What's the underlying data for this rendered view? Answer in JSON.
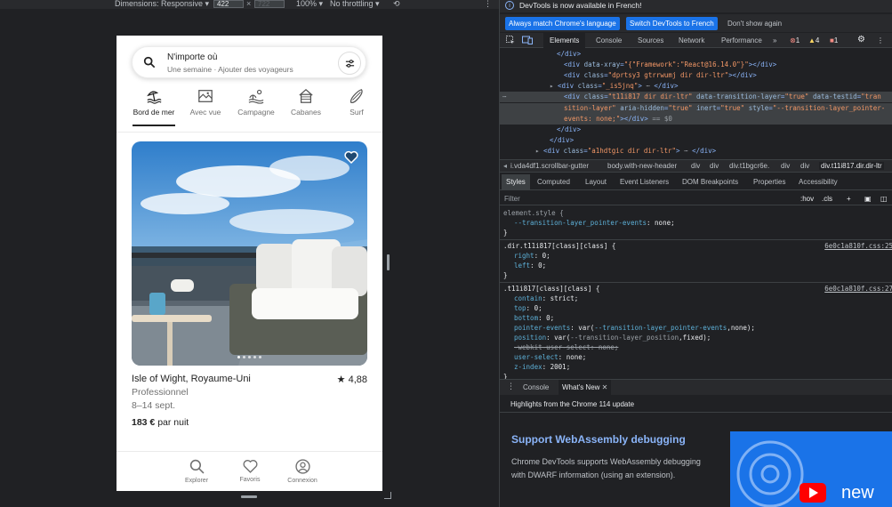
{
  "device_toolbar": {
    "dimensions_label": "Dimensions: Responsive ▾",
    "width": "422",
    "height": "722",
    "zoom": "100% ▾",
    "throttling": "No throttling ▾"
  },
  "search": {
    "title": "N'importe où",
    "subtitle": "Une semaine · Ajouter des voyageurs"
  },
  "categories": [
    {
      "label": "Bord de mer",
      "icon": "beach-icon",
      "active": true
    },
    {
      "label": "Avec vue",
      "icon": "view-icon"
    },
    {
      "label": "Campagne",
      "icon": "countryside-icon"
    },
    {
      "label": "Cabanes",
      "icon": "cabin-icon"
    },
    {
      "label": "Surf",
      "icon": "surf-icon"
    }
  ],
  "listing": {
    "title": "Isle of Wight, Royaume-Uni",
    "rating": "★ 4,88",
    "host": "Professionnel",
    "dates": "8–14 sept.",
    "price": "183 €",
    "price_suffix": " par nuit"
  },
  "tabbar": [
    {
      "label": "Explorer",
      "icon": "search-icon"
    },
    {
      "label": "Favoris",
      "icon": "heart-icon"
    },
    {
      "label": "Connexion",
      "icon": "profile-icon"
    }
  ],
  "devtools": {
    "info_text": "DevTools is now available in French!",
    "btn_match": "Always match Chrome's language",
    "btn_switch": "Switch DevTools to French",
    "btn_dont": "Don't show again",
    "tabs": [
      "Elements",
      "Console",
      "Sources",
      "Network",
      "Performance",
      "»"
    ],
    "errors": "1",
    "warnings": "4",
    "issues": "1",
    "code_lines": [
      {
        "indent": 8,
        "text": "</div>",
        "cls": "tag"
      },
      {
        "indent": 9,
        "parts": [
          [
            "tag",
            "<div "
          ],
          [
            "an",
            "data-xray"
          ],
          [
            "tag",
            "="
          ],
          [
            "av",
            "\"{\"Framework\":\"React@16.14.0\"}\""
          ],
          [
            "tag",
            "></div>"
          ]
        ]
      },
      {
        "indent": 9,
        "parts": [
          [
            "tag",
            "<div "
          ],
          [
            "an",
            "class"
          ],
          [
            "tag",
            "="
          ],
          [
            "av",
            "\"dprtsy3 gtrrwumj dir dir-ltr\""
          ],
          [
            "tag",
            "></div>"
          ]
        ]
      },
      {
        "indent": 8,
        "arrow": true,
        "parts": [
          [
            "tag",
            "<div "
          ],
          [
            "an",
            "class"
          ],
          [
            "tag",
            "="
          ],
          [
            "av",
            "\"_is5jnq\""
          ],
          [
            "tag",
            ">"
          ],
          [
            "gr",
            " ⋯ "
          ],
          [
            "tag",
            "</div>"
          ]
        ]
      },
      {
        "indent": 9,
        "sel": true,
        "parts": [
          [
            "tag",
            "<div "
          ],
          [
            "an",
            "class"
          ],
          [
            "tag",
            "="
          ],
          [
            "av",
            "\"t11i817 dir dir-ltr\" "
          ],
          [
            "an",
            "data-transition-layer"
          ],
          [
            "tag",
            "="
          ],
          [
            "av",
            "\"true\" "
          ],
          [
            "an",
            "data-testid"
          ],
          [
            "tag",
            "="
          ],
          [
            "av",
            "\"tran"
          ]
        ]
      },
      {
        "indent": 9,
        "sel": true,
        "parts": [
          [
            "av",
            "sition-layer\" "
          ],
          [
            "an",
            "aria-hidden"
          ],
          [
            "tag",
            "="
          ],
          [
            "av",
            "\"true\" "
          ],
          [
            "an",
            "inert"
          ],
          [
            "tag",
            "="
          ],
          [
            "av",
            "\"true\" "
          ],
          [
            "an",
            "style"
          ],
          [
            "tag",
            "="
          ],
          [
            "av",
            "\"--transition-layer_pointer-"
          ]
        ]
      },
      {
        "indent": 9,
        "sel": true,
        "parts": [
          [
            "av",
            "events: none;\""
          ],
          [
            "tag",
            "></div>"
          ],
          [
            "gr",
            " == $0"
          ]
        ]
      },
      {
        "indent": 8,
        "parts": [
          [
            "tag",
            "</div>"
          ]
        ]
      },
      {
        "indent": 7,
        "parts": [
          [
            "tag",
            "</div>"
          ]
        ]
      },
      {
        "indent": 6,
        "arrow": true,
        "parts": [
          [
            "tag",
            "<div "
          ],
          [
            "an",
            "class"
          ],
          [
            "tag",
            "="
          ],
          [
            "av",
            "\"a1hdtgic dir dir-ltr\""
          ],
          [
            "tag",
            ">"
          ],
          [
            "gr",
            " ⋯ "
          ],
          [
            "tag",
            "</div>"
          ]
        ]
      },
      {
        "indent": 6,
        "parts": [
          [
            "tag",
            "</div>"
          ]
        ]
      }
    ],
    "breadcrumbs": [
      "i.vda4df1.scrollbar-gutter",
      "body.with-new-header",
      "div",
      "div",
      "div.t1bgcr6e.",
      "div",
      "div",
      "div.t11i817.dir.dir-ltr"
    ],
    "subtabs": [
      "Styles",
      "Computed",
      "Layout",
      "Event Listeners",
      "DOM Breakpoints",
      "Properties",
      "Accessibility"
    ],
    "filter_placeholder": "Filter",
    "filter_hov": ":hov",
    "filter_cls": ".cls",
    "style_src1": "6e0c1a810f.css:25",
    "style_src2": "6e0c1a810f.css:27",
    "drawer_tabs": [
      "Console",
      "What's New"
    ],
    "highlights": "Highlights from the Chrome 114 update",
    "whatsnew_title": "Support WebAssembly debugging",
    "whatsnew_text": "Chrome DevTools supports WebAssembly debugging with DWARF information (using an extension).",
    "promo_text": "new"
  },
  "colors": {
    "accent": "#1a73e8",
    "link": "#8ab4f8"
  }
}
